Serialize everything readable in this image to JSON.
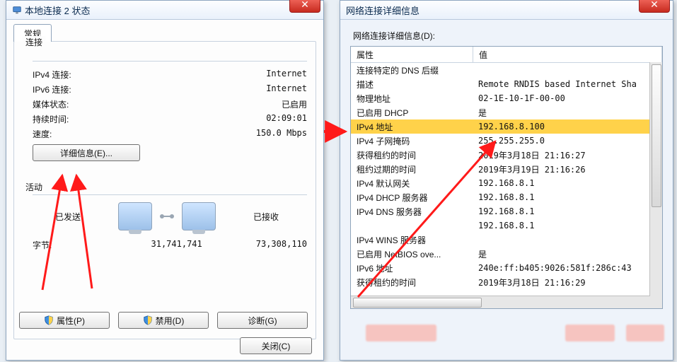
{
  "status_window": {
    "title": "本地连接 2 状态",
    "tab_general": "常规",
    "group_connection": "连接",
    "rows": {
      "ipv4_label": "IPv4 连接:",
      "ipv4_value": "Internet",
      "ipv6_label": "IPv6 连接:",
      "ipv6_value": "Internet",
      "media_label": "媒体状态:",
      "media_value": "已启用",
      "duration_label": "持续时间:",
      "duration_value": "02:09:01",
      "speed_label": "速度:",
      "speed_value": "150.0 Mbps"
    },
    "details_btn": "详细信息(E)...",
    "group_activity": "活动",
    "sent_label": "已发送",
    "recv_label": "已接收",
    "bytes_label": "字节:",
    "bytes_sent": "31,741,741",
    "bytes_recv": "73,308,110",
    "btn_properties": "属性(P)",
    "btn_disable": "禁用(D)",
    "btn_diagnose": "诊断(G)",
    "btn_close": "关闭(C)"
  },
  "details_window": {
    "title": "网络连接详细信息",
    "header_label": "网络连接详细信息(D):",
    "col_property": "属性",
    "col_value": "值",
    "rows": [
      {
        "p": "连接特定的 DNS 后缀",
        "v": ""
      },
      {
        "p": "描述",
        "v": "Remote RNDIS based Internet Sha"
      },
      {
        "p": "物理地址",
        "v": "02-1E-10-1F-00-00"
      },
      {
        "p": "已启用 DHCP",
        "v": "是"
      },
      {
        "p": "IPv4 地址",
        "v": "192.168.8.100",
        "hl": true
      },
      {
        "p": "IPv4 子网掩码",
        "v": "255.255.255.0"
      },
      {
        "p": "获得租约的时间",
        "v": "2019年3月18日 21:16:27"
      },
      {
        "p": "租约过期的时间",
        "v": "2019年3月19日 21:16:26"
      },
      {
        "p": "IPv4 默认网关",
        "v": "192.168.8.1"
      },
      {
        "p": "IPv4 DHCP 服务器",
        "v": "192.168.8.1"
      },
      {
        "p": "IPv4 DNS 服务器",
        "v": "192.168.8.1"
      },
      {
        "p": "",
        "v": "192.168.8.1"
      },
      {
        "p": "IPv4 WINS 服务器",
        "v": ""
      },
      {
        "p": "已启用 NetBIOS ove...",
        "v": "是"
      },
      {
        "p": "IPv6 地址",
        "v": "240e:ff:b405:9026:581f:286c:43"
      },
      {
        "p": "获得租约的时间",
        "v": "2019年3月18日 21:16:29"
      }
    ]
  }
}
